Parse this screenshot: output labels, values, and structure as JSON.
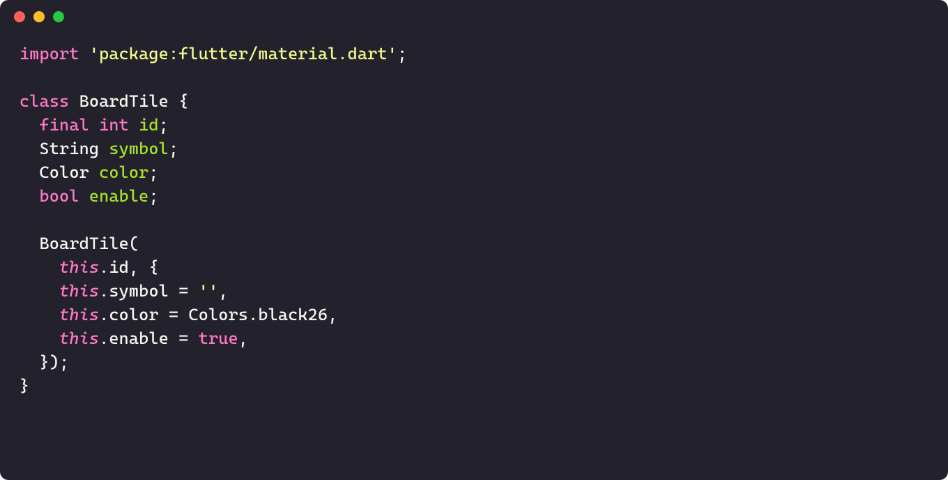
{
  "window": {
    "buttons": {
      "close": "close",
      "minimize": "minimize",
      "maximize": "maximize"
    }
  },
  "code": {
    "language": "dart",
    "tokens": [
      [
        {
          "t": "keyword",
          "v": "import"
        },
        {
          "t": "punct",
          "v": " "
        },
        {
          "t": "string",
          "v": "'package:flutter/material.dart'"
        },
        {
          "t": "punct",
          "v": ";"
        }
      ],
      [],
      [
        {
          "t": "keyword",
          "v": "class"
        },
        {
          "t": "punct",
          "v": " "
        },
        {
          "t": "classname",
          "v": "BoardTile"
        },
        {
          "t": "punct",
          "v": " {"
        }
      ],
      [
        {
          "t": "punct",
          "v": "  "
        },
        {
          "t": "keyword",
          "v": "final"
        },
        {
          "t": "punct",
          "v": " "
        },
        {
          "t": "keyword",
          "v": "int"
        },
        {
          "t": "punct",
          "v": " "
        },
        {
          "t": "ident",
          "v": "id"
        },
        {
          "t": "punct",
          "v": ";"
        }
      ],
      [
        {
          "t": "punct",
          "v": "  "
        },
        {
          "t": "type",
          "v": "String"
        },
        {
          "t": "punct",
          "v": " "
        },
        {
          "t": "ident",
          "v": "symbol"
        },
        {
          "t": "punct",
          "v": ";"
        }
      ],
      [
        {
          "t": "punct",
          "v": "  "
        },
        {
          "t": "type",
          "v": "Color"
        },
        {
          "t": "punct",
          "v": " "
        },
        {
          "t": "ident",
          "v": "color"
        },
        {
          "t": "punct",
          "v": ";"
        }
      ],
      [
        {
          "t": "punct",
          "v": "  "
        },
        {
          "t": "keyword",
          "v": "bool"
        },
        {
          "t": "punct",
          "v": " "
        },
        {
          "t": "ident",
          "v": "enable"
        },
        {
          "t": "punct",
          "v": ";"
        }
      ],
      [],
      [
        {
          "t": "punct",
          "v": "  "
        },
        {
          "t": "classname",
          "v": "BoardTile"
        },
        {
          "t": "punct",
          "v": "("
        }
      ],
      [
        {
          "t": "punct",
          "v": "    "
        },
        {
          "t": "this",
          "v": "this"
        },
        {
          "t": "punct",
          "v": "."
        },
        {
          "t": "prop",
          "v": "id"
        },
        {
          "t": "punct",
          "v": ", {"
        }
      ],
      [
        {
          "t": "punct",
          "v": "    "
        },
        {
          "t": "this",
          "v": "this"
        },
        {
          "t": "punct",
          "v": "."
        },
        {
          "t": "prop",
          "v": "symbol"
        },
        {
          "t": "punct",
          "v": " = "
        },
        {
          "t": "string",
          "v": "''"
        },
        {
          "t": "punct",
          "v": ","
        }
      ],
      [
        {
          "t": "punct",
          "v": "    "
        },
        {
          "t": "this",
          "v": "this"
        },
        {
          "t": "punct",
          "v": "."
        },
        {
          "t": "prop",
          "v": "color"
        },
        {
          "t": "punct",
          "v": " = "
        },
        {
          "t": "const",
          "v": "Colors"
        },
        {
          "t": "punct",
          "v": "."
        },
        {
          "t": "prop",
          "v": "black26"
        },
        {
          "t": "punct",
          "v": ","
        }
      ],
      [
        {
          "t": "punct",
          "v": "    "
        },
        {
          "t": "this",
          "v": "this"
        },
        {
          "t": "punct",
          "v": "."
        },
        {
          "t": "prop",
          "v": "enable"
        },
        {
          "t": "punct",
          "v": " = "
        },
        {
          "t": "keyword",
          "v": "true"
        },
        {
          "t": "punct",
          "v": ","
        }
      ],
      [
        {
          "t": "punct",
          "v": "  });"
        }
      ],
      [
        {
          "t": "punct",
          "v": "}"
        }
      ]
    ]
  }
}
